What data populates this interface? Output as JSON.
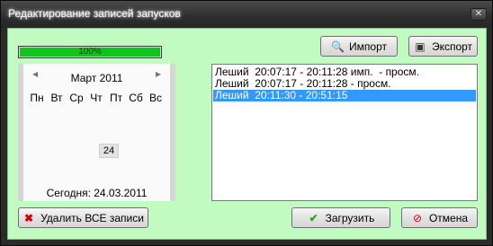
{
  "window": {
    "title": "Редактирование записей запусков",
    "close_glyph": "✕"
  },
  "progress": {
    "value": 100,
    "label": "100%"
  },
  "toolbar": {
    "import_label": "Импорт",
    "export_label": "Экспорт"
  },
  "calendar": {
    "prev_glyph": "◀",
    "next_glyph": "▶",
    "month": "Март 2011",
    "weekdays": [
      "Пн",
      "Вт",
      "Ср",
      "Чт",
      "Пт",
      "Сб",
      "Вс"
    ],
    "selected_day": "24",
    "today": "Сегодня: 24.03.2011"
  },
  "log": {
    "rows": [
      "Леший  20:07:17 - 20:11:28 имп.  - просм.",
      "Леший  20:07:17 - 20:11:28 - просм.",
      "Леший  20:11:30 - 20:51:15"
    ],
    "selected_index": 2
  },
  "actions": {
    "delete_all_label": "Удалить ВСЕ записи",
    "load_label": "Загрузить",
    "cancel_label": "Отмена"
  },
  "icons": {
    "import": "import-icon",
    "export": "export-icon",
    "delete": "delete-icon",
    "load": "checkmark-icon",
    "cancel": "cancel-icon"
  },
  "colors": {
    "client_bg": "#c1fbc1",
    "progress_fill": "#12c41a",
    "selection": "#3399ff"
  }
}
